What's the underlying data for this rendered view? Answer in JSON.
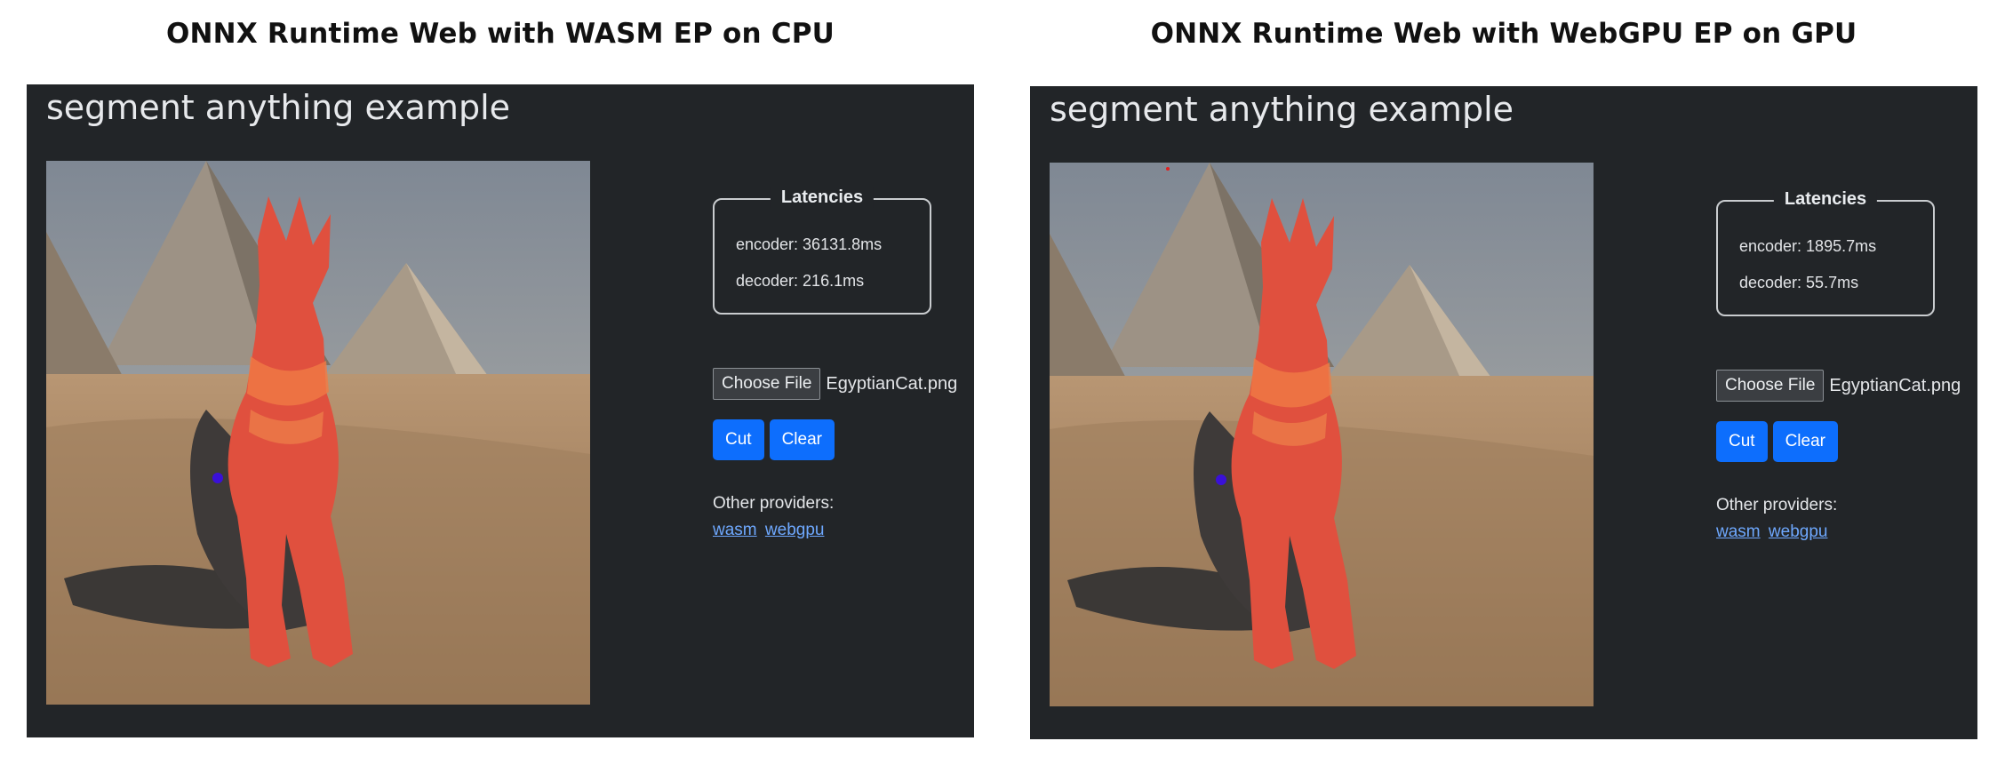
{
  "panels": [
    {
      "caption": "ONNX Runtime Web with WASM EP on CPU",
      "title": "segment anything example",
      "latencies": {
        "legend": "Latencies",
        "encoder": "encoder: 36131.8ms",
        "decoder": "decoder: 216.1ms"
      },
      "file": {
        "button_label": "Choose File",
        "file_name": "EgyptianCat.png"
      },
      "buttons": {
        "cut": "Cut",
        "clear": "Clear"
      },
      "providers": {
        "label": "Other providers:",
        "links": [
          "wasm",
          "webgpu"
        ]
      }
    },
    {
      "caption": "ONNX Runtime Web with WebGPU EP on GPU",
      "title": "segment anything example",
      "latencies": {
        "legend": "Latencies",
        "encoder": "encoder: 1895.7ms",
        "decoder": "decoder: 55.7ms"
      },
      "file": {
        "button_label": "Choose File",
        "file_name": "EgyptianCat.png"
      },
      "buttons": {
        "cut": "Cut",
        "clear": "Clear"
      },
      "providers": {
        "label": "Other providers:",
        "links": [
          "wasm",
          "webgpu"
        ]
      }
    }
  ],
  "colors": {
    "page_background": "#222528",
    "primary_button": "#0d6efd",
    "link": "#6ea8fe",
    "mask_overlay": "#e0503e",
    "prompt_point": "#3a10d8"
  }
}
